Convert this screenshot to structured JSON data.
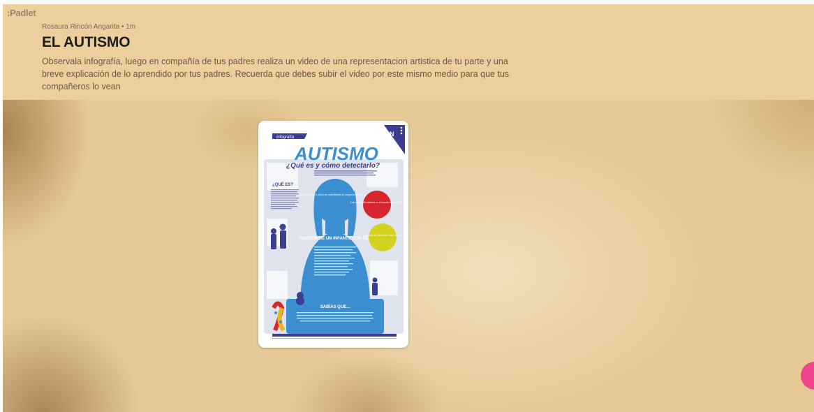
{
  "app": {
    "logo": ":Padlet"
  },
  "post_header": {
    "author": "Rosaura Rincón Angarita • 1m",
    "title": "EL AUTISMO",
    "description": "Observala infografía, luego en compañía de tus padres realiza un video de una representacion artistica de tu parte y una breve explicación de lo aprendido por tus padres. Recuerda que debes subir el video por este mismo medio para que tus compañeros lo vean"
  },
  "infographic": {
    "tag": "infografía",
    "heading": "AUTISMO",
    "subheading": "¿Qué es y cómo detectarlo?",
    "que_es": "¿QUÉ ES?",
    "indicios": "INDICIOS DE UN INFANTE CON TEA",
    "sabias": "SABÍAS QUE...",
    "corner_badge": "N",
    "stat_red": "1 de cada 160 infantes en el mundo tiene un TEA",
    "stat_yellow": "1 de cada 68 personas tiene un TEA",
    "bubble_age": "Antes de los 3 años se manifiesta la mayoría de los casos",
    "colors": {
      "blue": "#3b8fd0",
      "navy": "#3a3f8f",
      "red": "#d8262e",
      "yellow": "#d2d21e",
      "puzzle": "#dfe3ee"
    }
  },
  "colors": {
    "header_bg": "#edcf9d",
    "fab": "#f0468e"
  }
}
